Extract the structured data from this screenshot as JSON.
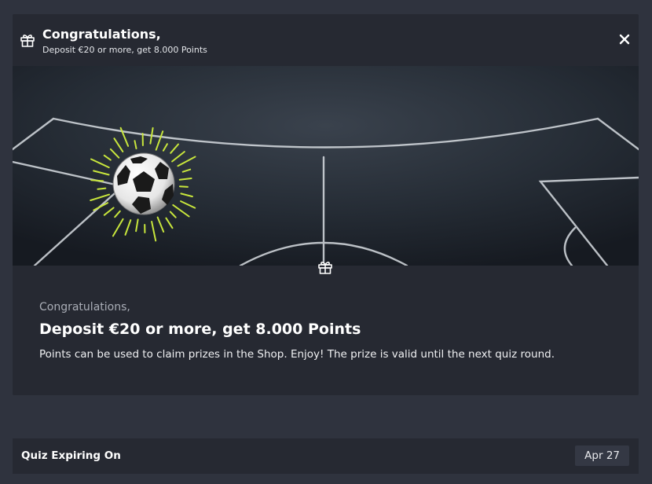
{
  "header": {
    "title": "Congratulations,",
    "subtitle": "Deposit €20 or more, get 8.000 Points",
    "icon": "gift-icon",
    "close_icon": "close-icon"
  },
  "banner": {
    "image": "football-on-chalkboard-pitch"
  },
  "content": {
    "icon": "gift-icon",
    "label": "Congratulations,",
    "title": "Deposit €20 or more, get 8.000 Points",
    "description": "Points can be used to claim prizes in the Shop. Enjoy! The prize is valid until the next quiz round."
  },
  "expiry": {
    "label": "Quiz Expiring On",
    "date": "Apr 27"
  },
  "colors": {
    "page_background": "#2f333e",
    "panel_background": "#262932",
    "date_badge_background": "#343844",
    "burst_accent": "#c8e63c"
  }
}
